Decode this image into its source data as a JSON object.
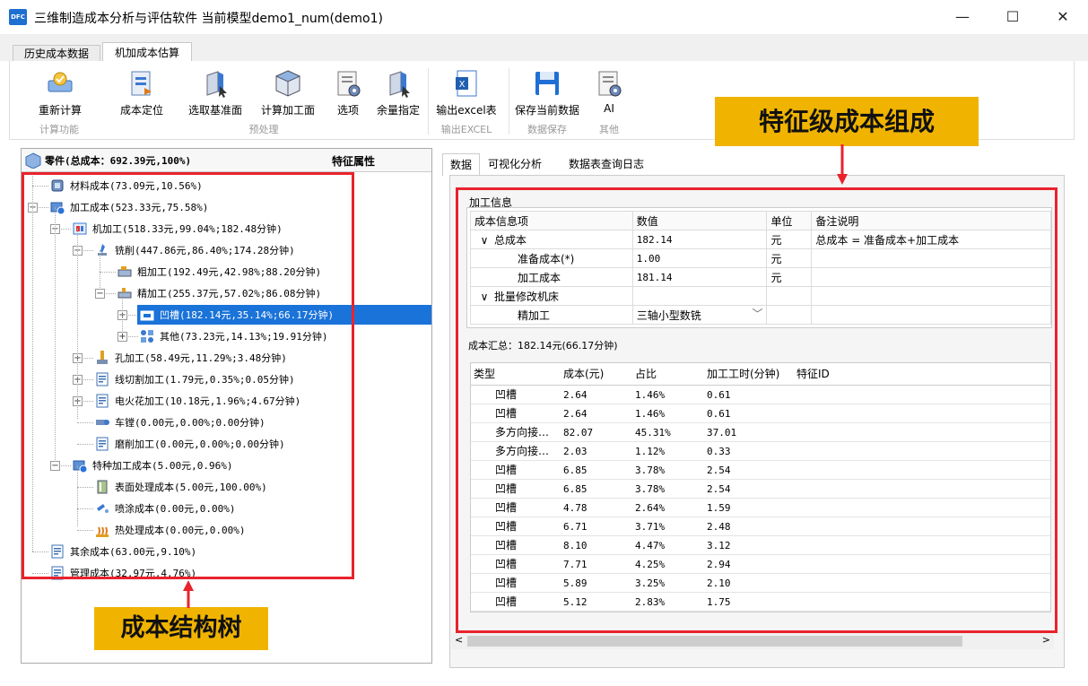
{
  "window": {
    "app_icon": "DFC",
    "title": "三维制造成本分析与评估软件 当前模型demo1_num(demo1)",
    "minimize": "—",
    "maximize": "☐",
    "close": "✕"
  },
  "main_tabs": [
    {
      "label": "历史成本数据",
      "active": false
    },
    {
      "label": "机加成本估算",
      "active": true
    }
  ],
  "ribbon": {
    "buttons": [
      {
        "label": "重新计算",
        "icon": "recalculate-icon"
      },
      {
        "label": "成本定位",
        "icon": "cost-locate-icon"
      },
      {
        "label": "选取基准面",
        "icon": "select-datum-icon"
      },
      {
        "label": "计算加工面",
        "icon": "compute-surface-icon"
      },
      {
        "label": "选项",
        "icon": "options-icon"
      },
      {
        "label": "余量指定",
        "icon": "allowance-icon"
      },
      {
        "label": "输出excel表",
        "icon": "excel-icon"
      },
      {
        "label": "保存当前数据",
        "icon": "save-icon"
      },
      {
        "label": "AI",
        "icon": "ai-icon"
      }
    ],
    "groups": [
      "计算功能",
      "预处理",
      "输出EXCEL",
      "数据保存",
      "其他"
    ]
  },
  "tree": {
    "header_title": "零件(总成本：692.39元,100%)",
    "header_attr": "特征属性",
    "nodes": [
      "材料成本(73.09元,10.56%)",
      "加工成本(523.33元,75.58%)",
      "机加工(518.33元,99.04%;182.48分钟)",
      "铣削(447.86元,86.40%;174.28分钟)",
      "粗加工(192.49元,42.98%;88.20分钟)",
      "精加工(255.37元,57.02%;86.08分钟)",
      "凹槽(182.14元,35.14%;66.17分钟)",
      "其他(73.23元,14.13%;19.91分钟)",
      "孔加工(58.49元,11.29%;3.48分钟)",
      "线切割加工(1.79元,0.35%;0.05分钟)",
      "电火花加工(10.18元,1.96%;4.67分钟)",
      "车镗(0.00元,0.00%;0.00分钟)",
      "磨削加工(0.00元,0.00%;0.00分钟)",
      "特种加工成本(5.00元,0.96%)",
      "表面处理成本(5.00元,100.00%)",
      "喷涂成本(0.00元,0.00%)",
      "热处理成本(0.00元,0.00%)",
      "其余成本(63.00元,9.10%)",
      "管理成本(32.97元,4.76%)"
    ]
  },
  "right_tabs": [
    "数据",
    "可视化分析",
    "数据表查询日志"
  ],
  "info": {
    "legend": "加工信息",
    "headers": [
      "成本信息项",
      "数值",
      "单位",
      "备注说明"
    ],
    "rows": [
      {
        "toggle": "∨",
        "item": "总成本",
        "value": "182.14",
        "unit": "元",
        "note": "总成本 = 准备成本+加工成本"
      },
      {
        "toggle": "",
        "item": "准备成本(*)",
        "value": "1.00",
        "unit": "元",
        "note": ""
      },
      {
        "toggle": "",
        "item": "加工成本",
        "value": "181.14",
        "unit": "元",
        "note": ""
      },
      {
        "toggle": "∨",
        "item": "批量修改机床",
        "value": "",
        "unit": "",
        "note": ""
      },
      {
        "toggle": "",
        "item": "精加工",
        "value": "三轴小型数铣",
        "unit": "",
        "note": ""
      }
    ]
  },
  "summary": "成本汇总：182.14元(66.17分钟)",
  "cost_table": {
    "headers": [
      "类型",
      "成本(元)",
      "占比",
      "加工工时(分钟)",
      "特征ID"
    ],
    "rows": [
      [
        "凹槽",
        "2.64",
        "1.46%",
        "0.61",
        ""
      ],
      [
        "凹槽",
        "2.64",
        "1.46%",
        "0.61",
        ""
      ],
      [
        "多方向接…",
        "82.07",
        "45.31%",
        "37.01",
        ""
      ],
      [
        "多方向接…",
        "2.03",
        "1.12%",
        "0.33",
        ""
      ],
      [
        "凹槽",
        "6.85",
        "3.78%",
        "2.54",
        ""
      ],
      [
        "凹槽",
        "6.85",
        "3.78%",
        "2.54",
        ""
      ],
      [
        "凹槽",
        "4.78",
        "2.64%",
        "1.59",
        ""
      ],
      [
        "凹槽",
        "6.71",
        "3.71%",
        "2.48",
        ""
      ],
      [
        "凹槽",
        "8.10",
        "4.47%",
        "3.12",
        ""
      ],
      [
        "凹槽",
        "7.71",
        "4.25%",
        "2.94",
        ""
      ],
      [
        "凹槽",
        "5.89",
        "3.25%",
        "2.10",
        ""
      ],
      [
        "凹槽",
        "5.12",
        "2.83%",
        "1.75",
        ""
      ]
    ]
  },
  "scroll": {
    "left": "<",
    "right": ">"
  },
  "annotations": {
    "top_label": "特征级成本组成",
    "bottom_label": "成本结构树",
    "color_box": "#e8232d",
    "color_label": "#f0b400"
  }
}
